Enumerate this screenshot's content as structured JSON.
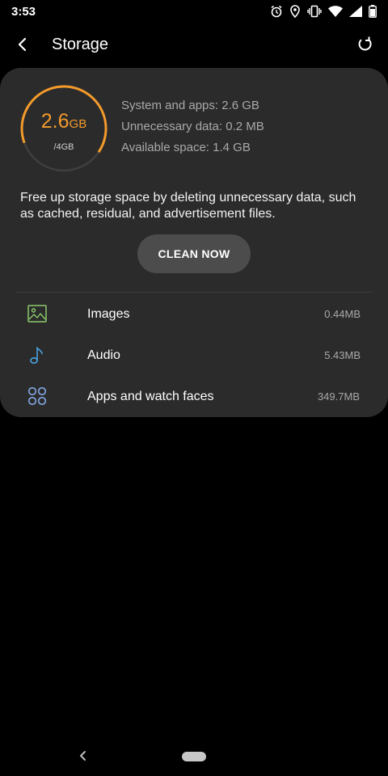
{
  "status_bar": {
    "time": "3:53",
    "icons": [
      "alarm-icon",
      "location-icon",
      "vibrate-icon",
      "wifi-icon",
      "signal-icon",
      "battery-icon"
    ]
  },
  "app_bar": {
    "title": "Storage",
    "back_icon": "back-arrow-icon",
    "refresh_icon": "refresh-icon"
  },
  "storage": {
    "used_value": "2.6",
    "used_unit": "GB",
    "total": "/4GB",
    "used_fraction": 0.65,
    "accent_color": "#f39a2b",
    "breakdown": [
      "System and apps: 2.6 GB",
      "Unnecessary data: 0.2 MB",
      "Available space: 1.4 GB"
    ],
    "description": "Free up storage space by deleting unnecessary data, such as cached, residual, and advertisement files.",
    "clean_button": "CLEAN NOW"
  },
  "categories": [
    {
      "label": "Images",
      "size": "0.44MB",
      "icon": "image-icon",
      "icon_color": "#8cc96c"
    },
    {
      "label": "Audio",
      "size": "5.43MB",
      "icon": "music-note-icon",
      "icon_color": "#4aa8e8"
    },
    {
      "label": "Apps and watch faces",
      "size": "349.7MB",
      "icon": "apps-grid-icon",
      "icon_color": "#8ab0f0"
    }
  ],
  "nav_bar": {
    "back_icon": "nav-back-icon",
    "home_icon": "home-pill-icon"
  }
}
